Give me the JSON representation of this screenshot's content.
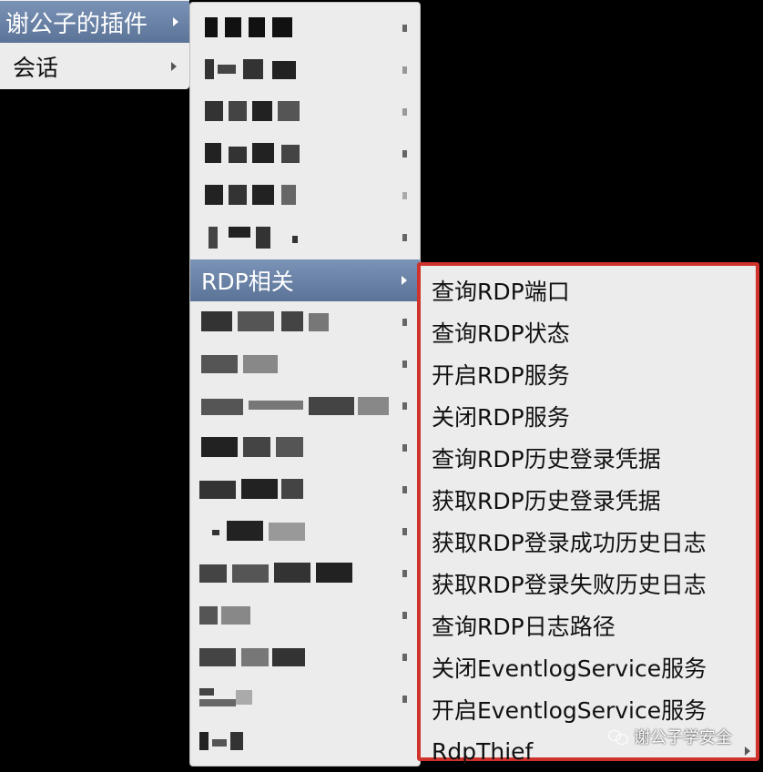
{
  "menu1": {
    "items": [
      {
        "label": "谢公子的插件"
      },
      {
        "label": "会话"
      }
    ]
  },
  "menu2": {
    "rdp_item": "RDP相关"
  },
  "menu3": {
    "items": [
      "查询RDP端口",
      "查询RDP状态",
      "开启RDP服务",
      "关闭RDP服务",
      "查询RDP历史登录凭据",
      "获取RDP历史登录凭据",
      "获取RDP登录成功历史日志",
      "获取RDP登录失败历史日志",
      "查询RDP日志路径",
      "关闭EventlogService服务",
      "开启EventlogService服务",
      "RdpThief"
    ],
    "highlight_border_color": "#d0322c"
  },
  "watermark": "谢公子学安全",
  "icons": [
    "submenu-arrow-icon",
    "wechat-icon"
  ],
  "colors": {
    "menu_bg": "#ececec",
    "highlight": "#6a82a6",
    "desktop": "#000000"
  }
}
